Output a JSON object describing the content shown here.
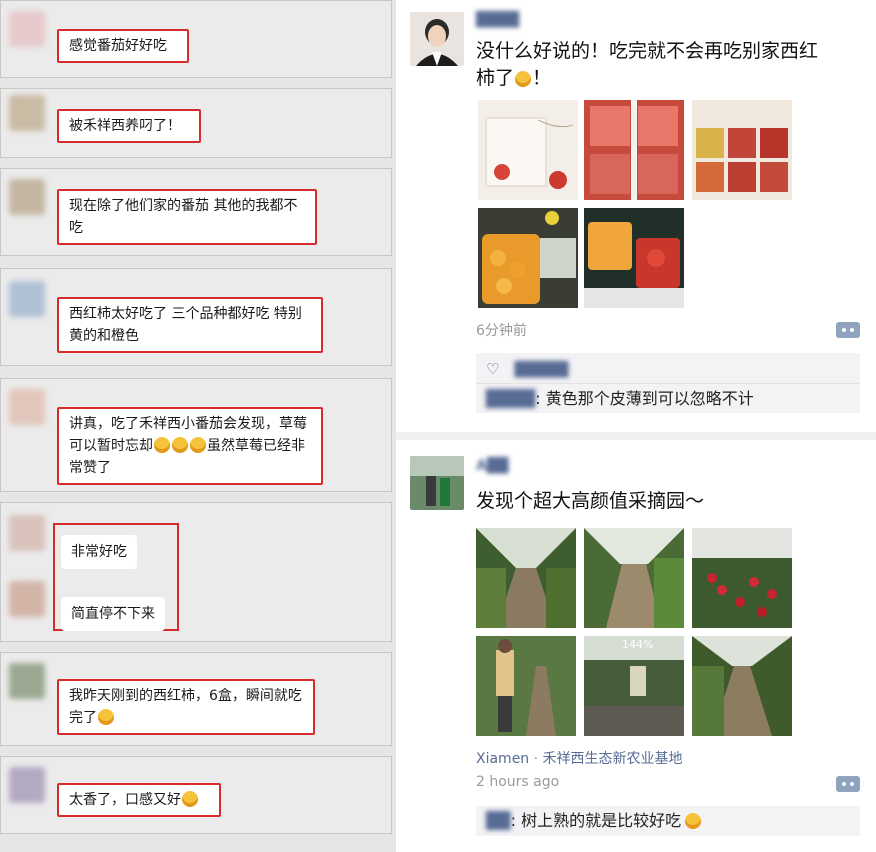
{
  "chats": [
    {
      "text": "感觉番茄好好吃",
      "emojis": 0
    },
    {
      "text": "被禾祥西养叼了！",
      "emojis": 0
    },
    {
      "text": "现在除了他们家的番茄 其他的我都不吃",
      "emojis": 0
    },
    {
      "text": "西红柿太好吃了 三个品种都好吃 特别黄的和橙色",
      "emojis": 0
    },
    {
      "text_a": "讲真，吃了禾祥西小番茄会发现，草莓可以暂时忘却",
      "text_b": "虽然草莓已经非常赞了",
      "emojis": 3
    },
    {
      "line1": "非常好吃",
      "line2": "简直停不下来"
    },
    {
      "text": "我昨天刚到的西红柿，6盒，瞬间就吃完了",
      "emojis": 1
    },
    {
      "text": "太香了，口感又好",
      "emojis": 1
    }
  ],
  "post1": {
    "author": "████",
    "text": "没什么好说的！吃完就不会再吃别家西红柿了",
    "text_end": "！",
    "time": "6分钟前",
    "like_name": "█████",
    "comment_name": "████",
    "comment_text": "黄色那个皮薄到可以忽略不计"
  },
  "post2": {
    "author": "A██",
    "text": "发现个超大高颜值采摘园～",
    "photo_overlay": "144%",
    "location_city": "Xiamen",
    "location_sep": " · ",
    "location_place": "禾祥西生态新农业基地",
    "time": "2 hours ago",
    "comment_name": "██",
    "comment_text": "树上熟的就是比较好吃"
  },
  "colors": {
    "highlight": "#d92b2b",
    "link": "#576b95"
  }
}
